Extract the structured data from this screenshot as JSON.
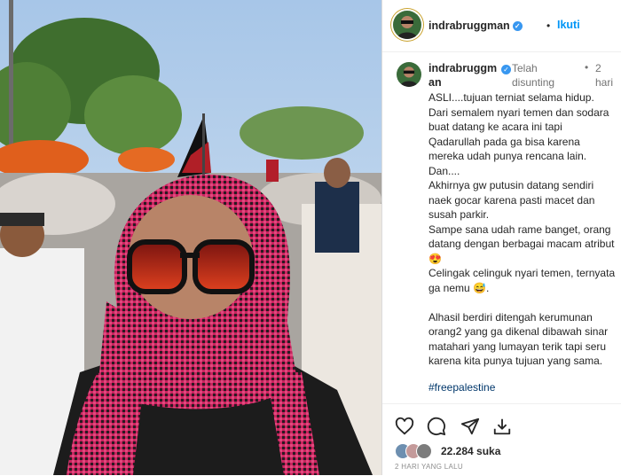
{
  "post": {
    "username": "indrabruggman",
    "follow_label": "Ikuti",
    "header_separator": "•",
    "edited_label": "Telah disunting",
    "separator": "•",
    "time_ago": "2 hari",
    "caption": [
      "ASLI....tujuan terniat selama hidup.",
      "Dari semalem nyari temen dan sodara buat datang ke acara ini tapi Qadarullah pada ga bisa karena mereka udah punya rencana lain.",
      "Dan....",
      "Akhirnya gw putusin datang sendiri naek gocar karena pasti macet dan susah parkir.",
      "Sampe sana udah rame banget, orang datang dengan berbagai macam atribut😍",
      "Celingak celinguk nyari temen, ternyata ga nemu 😅.",
      "",
      "Alhasil berdiri ditengah kerumunan orang2 yang ga dikenal dibawah sinar matahari yang lumayan terik tapi seru karena kita punya tujuan yang sama."
    ],
    "hashtag": "#freepalestine",
    "likes": "22.284 suka",
    "timestamp": "2 HARI YANG LALU"
  },
  "icons": {
    "like": "heart-icon",
    "comment": "comment-icon",
    "share": "send-icon",
    "save": "download-icon",
    "verified": "verified-icon"
  },
  "colors": {
    "follow": "#0095f6",
    "verified": "#3897f0",
    "hashtag": "#00376b",
    "scarf": "#c8245e"
  }
}
